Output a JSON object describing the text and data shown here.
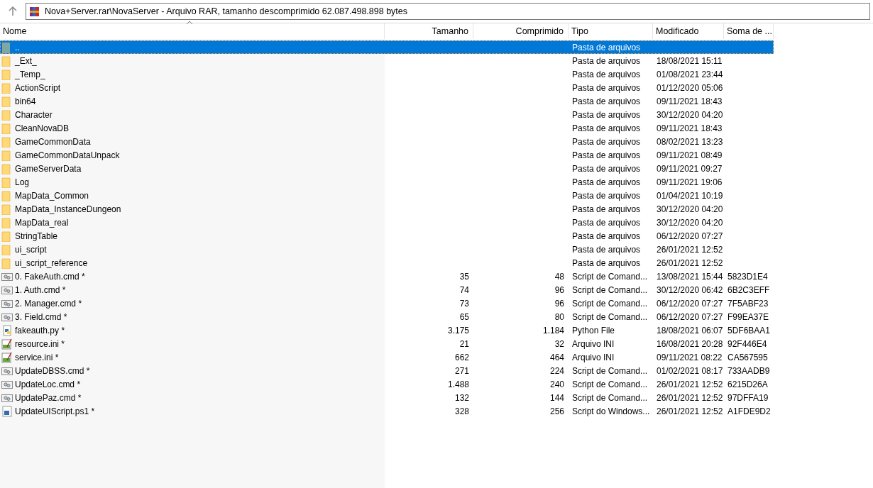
{
  "address": {
    "text": "Nova+Server.rar\\NovaServer - Arquivo RAR, tamanho descomprimido 62.087.498.898 bytes"
  },
  "table": {
    "columns": [
      {
        "label": "Nome",
        "sorted": true
      },
      {
        "label": "Tamanho",
        "sorted": false
      },
      {
        "label": "Comprimido",
        "sorted": false
      },
      {
        "label": "Tipo",
        "sorted": false
      },
      {
        "label": "Modificado",
        "sorted": false
      },
      {
        "label": "Soma de ...",
        "sorted": false
      }
    ],
    "rows": [
      {
        "kind": "parent",
        "selected": true,
        "cells": [
          "..",
          "",
          "",
          "Pasta de arquivos",
          "",
          ""
        ]
      },
      {
        "kind": "folder",
        "selected": false,
        "cells": [
          "_Ext_",
          "",
          "",
          "Pasta de arquivos",
          "18/08/2021 15:11",
          ""
        ]
      },
      {
        "kind": "folder",
        "selected": false,
        "cells": [
          "_Temp_",
          "",
          "",
          "Pasta de arquivos",
          "01/08/2021 23:44",
          ""
        ]
      },
      {
        "kind": "folder",
        "selected": false,
        "cells": [
          "ActionScript",
          "",
          "",
          "Pasta de arquivos",
          "01/12/2020 05:06",
          ""
        ]
      },
      {
        "kind": "folder",
        "selected": false,
        "cells": [
          "bin64",
          "",
          "",
          "Pasta de arquivos",
          "09/11/2021 18:43",
          ""
        ]
      },
      {
        "kind": "folder",
        "selected": false,
        "cells": [
          "Character",
          "",
          "",
          "Pasta de arquivos",
          "30/12/2020 04:20",
          ""
        ]
      },
      {
        "kind": "folder",
        "selected": false,
        "cells": [
          "CleanNovaDB",
          "",
          "",
          "Pasta de arquivos",
          "09/11/2021 18:43",
          ""
        ]
      },
      {
        "kind": "folder",
        "selected": false,
        "cells": [
          "GameCommonData",
          "",
          "",
          "Pasta de arquivos",
          "08/02/2021 13:23",
          ""
        ]
      },
      {
        "kind": "folder",
        "selected": false,
        "cells": [
          "GameCommonDataUnpack",
          "",
          "",
          "Pasta de arquivos",
          "09/11/2021 08:49",
          ""
        ]
      },
      {
        "kind": "folder",
        "selected": false,
        "cells": [
          "GameServerData",
          "",
          "",
          "Pasta de arquivos",
          "09/11/2021 09:27",
          ""
        ]
      },
      {
        "kind": "folder",
        "selected": false,
        "cells": [
          "Log",
          "",
          "",
          "Pasta de arquivos",
          "09/11/2021 19:06",
          ""
        ]
      },
      {
        "kind": "folder",
        "selected": false,
        "cells": [
          "MapData_Common",
          "",
          "",
          "Pasta de arquivos",
          "01/04/2021 10:19",
          ""
        ]
      },
      {
        "kind": "folder",
        "selected": false,
        "cells": [
          "MapData_InstanceDungeon",
          "",
          "",
          "Pasta de arquivos",
          "30/12/2020 04:20",
          ""
        ]
      },
      {
        "kind": "folder",
        "selected": false,
        "cells": [
          "MapData_real",
          "",
          "",
          "Pasta de arquivos",
          "30/12/2020 04:20",
          ""
        ]
      },
      {
        "kind": "folder",
        "selected": false,
        "cells": [
          "StringTable",
          "",
          "",
          "Pasta de arquivos",
          "06/12/2020 07:27",
          ""
        ]
      },
      {
        "kind": "folder",
        "selected": false,
        "cells": [
          "ui_script",
          "",
          "",
          "Pasta de arquivos",
          "26/01/2021 12:52",
          ""
        ]
      },
      {
        "kind": "folder",
        "selected": false,
        "cells": [
          "ui_script_reference",
          "",
          "",
          "Pasta de arquivos",
          "26/01/2021 12:52",
          ""
        ]
      },
      {
        "kind": "cmd",
        "selected": false,
        "cells": [
          "0. FakeAuth.cmd *",
          "35",
          "48",
          "Script de Comand...",
          "13/08/2021 15:44",
          "5823D1E4"
        ]
      },
      {
        "kind": "cmd",
        "selected": false,
        "cells": [
          "1. Auth.cmd *",
          "74",
          "96",
          "Script de Comand...",
          "30/12/2020 06:42",
          "6B2C3EFF"
        ]
      },
      {
        "kind": "cmd",
        "selected": false,
        "cells": [
          "2. Manager.cmd *",
          "73",
          "96",
          "Script de Comand...",
          "06/12/2020 07:27",
          "7F5ABF23"
        ]
      },
      {
        "kind": "cmd",
        "selected": false,
        "cells": [
          "3. Field.cmd *",
          "65",
          "80",
          "Script de Comand...",
          "06/12/2020 07:27",
          "F99EA37E"
        ]
      },
      {
        "kind": "python",
        "selected": false,
        "cells": [
          "fakeauth.py *",
          "3.175",
          "1.184",
          "Python File",
          "18/08/2021 06:07",
          "5DF6BAA1"
        ]
      },
      {
        "kind": "ini",
        "selected": false,
        "cells": [
          "resource.ini *",
          "21",
          "32",
          "Arquivo INI",
          "16/08/2021 20:28",
          "92F446E4"
        ]
      },
      {
        "kind": "ini",
        "selected": false,
        "cells": [
          "service.ini *",
          "662",
          "464",
          "Arquivo INI",
          "09/11/2021 08:22",
          "CA567595"
        ]
      },
      {
        "kind": "cmd",
        "selected": false,
        "cells": [
          "UpdateDBSS.cmd *",
          "271",
          "224",
          "Script de Comand...",
          "01/02/2021 08:17",
          "733AADB9"
        ]
      },
      {
        "kind": "cmd",
        "selected": false,
        "cells": [
          "UpdateLoc.cmd *",
          "1.488",
          "240",
          "Script de Comand...",
          "26/01/2021 12:52",
          "6215D26A"
        ]
      },
      {
        "kind": "cmd",
        "selected": false,
        "cells": [
          "UpdatePaz.cmd *",
          "132",
          "144",
          "Script de Comand...",
          "26/01/2021 12:52",
          "97DFFA19"
        ]
      },
      {
        "kind": "ps1",
        "selected": false,
        "cells": [
          "UpdateUIScript.ps1 *",
          "328",
          "256",
          "Script do Windows...",
          "26/01/2021 12:52",
          "A1FDE9D2"
        ]
      }
    ]
  }
}
